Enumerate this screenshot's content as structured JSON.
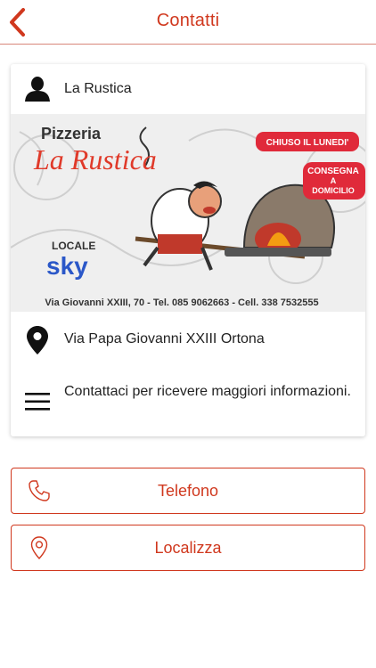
{
  "header": {
    "title": "Contatti"
  },
  "card": {
    "name": "La Rustica",
    "address": "Via Papa Giovanni XXIII Ortona",
    "info": "Contattaci per ricevere maggiori informazioni."
  },
  "photo": {
    "heading": "Pizzeria",
    "brand": "La Rustica",
    "closed_badge": "CHIUSO IL LUNEDI'",
    "delivery_badge_line1": "CONSEGNA",
    "delivery_badge_line2": "A",
    "delivery_badge_line3": "DOMICILIO",
    "sky_top": "LOCALE",
    "sky_logo": "sky",
    "footer": "Via Giovanni XXIII, 70 - Tel. 085 9062663 - Cell. 338 7532555"
  },
  "actions": {
    "phone_label": "Telefono",
    "locate_label": "Localizza"
  },
  "colors": {
    "accent": "#d0381e",
    "text": "#222222"
  }
}
